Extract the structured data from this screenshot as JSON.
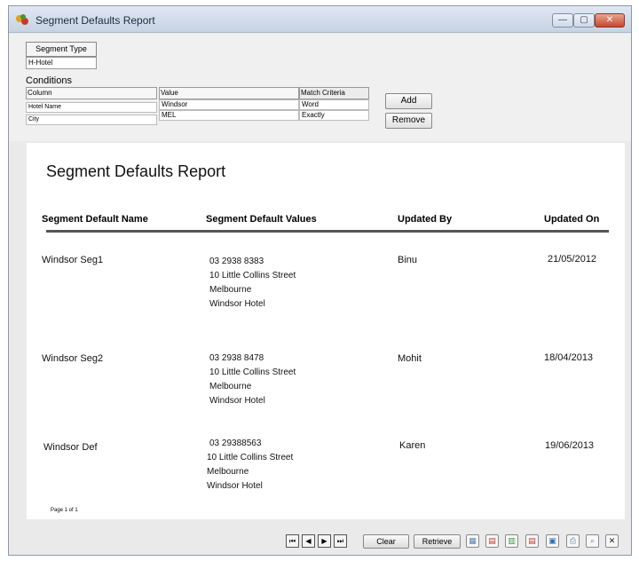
{
  "window": {
    "title": "Segment Defaults Report",
    "min_label": "—",
    "max_label": "▢",
    "close_label": "✕"
  },
  "filters": {
    "segment_type_label": "Segment Type",
    "segment_type_value": "H-Hotel",
    "conditions_label": "Conditions",
    "columns": [
      "Column",
      "Value",
      "Match Criteria"
    ],
    "rows": [
      {
        "column": "Hotel Name",
        "value": "Windsor",
        "match": "Word"
      },
      {
        "column": "City",
        "value": "MEL",
        "match": "Exactly"
      }
    ],
    "add_label": "Add",
    "remove_label": "Remove"
  },
  "report": {
    "title": "Segment Defaults Report",
    "headers": [
      "Segment Default Name",
      "Segment Default Values",
      "Updated By",
      "Updated On"
    ],
    "rows": [
      {
        "name": "Windsor Seg1",
        "values": [
          "03 2938 8383",
          "10 Little Collins Street",
          "Melbourne",
          "Windsor Hotel"
        ],
        "updated_by": "Binu",
        "updated_on": "21/05/2012"
      },
      {
        "name": "Windsor Seg2",
        "values": [
          "03 2938 8478",
          "10 Little Collins Street",
          "Melbourne",
          "Windsor Hotel"
        ],
        "updated_by": "Mohit",
        "updated_on": "18/04/2013"
      },
      {
        "name": "Windsor Def",
        "values": [
          "03 29388563",
          "10 Little Collins Street",
          "Melbourne",
          "Windsor Hotel"
        ],
        "updated_by": "Karen",
        "updated_on": "19/06/2013"
      }
    ],
    "page_info": "Page 1 of 1"
  },
  "toolbar": {
    "first_icon": "first-page-icon",
    "prev_icon": "prev-page-icon",
    "next_icon": "next-page-icon",
    "last_icon": "last-page-icon",
    "first_glyph": "⏮",
    "prev_glyph": "◀",
    "next_glyph": "▶",
    "last_glyph": "⏭",
    "clear_label": "Clear",
    "retrieve_label": "Retrieve",
    "export_icons": [
      "grid-icon",
      "pdf-icon",
      "excel-icon",
      "acrobat-icon",
      "word-icon",
      "print-icon",
      "preview-icon",
      "close-icon"
    ],
    "export_glyphs": [
      "▦",
      "▤",
      "▥",
      "▤",
      "▣",
      "⎙",
      "⌕",
      "✕"
    ],
    "export_colors": [
      "#5a7fb0",
      "#c43a2a",
      "#3d9a3d",
      "#c43a2a",
      "#2f6fb6",
      "#5a7fb0",
      "#5a7fb0",
      "#222222"
    ]
  }
}
